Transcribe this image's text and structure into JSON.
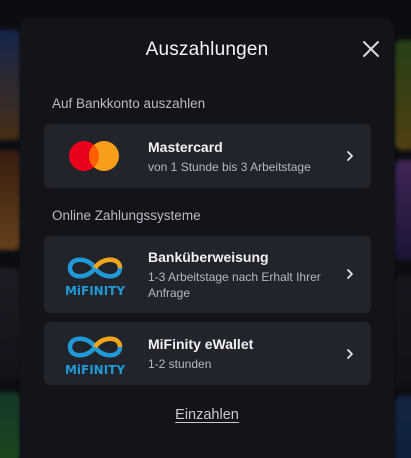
{
  "modal": {
    "title": "Auszahlungen",
    "close_icon": "close-icon"
  },
  "sections": {
    "bank": {
      "label": "Auf Bankkonto auszahlen"
    },
    "online": {
      "label": "Online Zahlungssysteme"
    }
  },
  "methods": [
    {
      "name": "Mastercard",
      "subtitle": "von 1 Stunde bis 3 Arbeitstage",
      "logo": "mastercard-logo"
    },
    {
      "name": "Banküberweisung",
      "subtitle": "1-3 Arbeitstage nach Erhalt Ihrer Anfrage",
      "logo": "mifinity-logo",
      "logo_text": "MiFINITY"
    },
    {
      "name": "MiFinity eWallet",
      "subtitle": "1-2 stunden",
      "logo": "mifinity-logo",
      "logo_text": "MiFINITY"
    }
  ],
  "footer": {
    "deposit_link": "Einzahlen"
  },
  "colors": {
    "modal_bg": "#131419",
    "card_bg": "#22242b",
    "mastercard_red": "#eb001b",
    "mastercard_orange": "#f79e1b",
    "mifinity_blue": "#1f9ad6"
  }
}
